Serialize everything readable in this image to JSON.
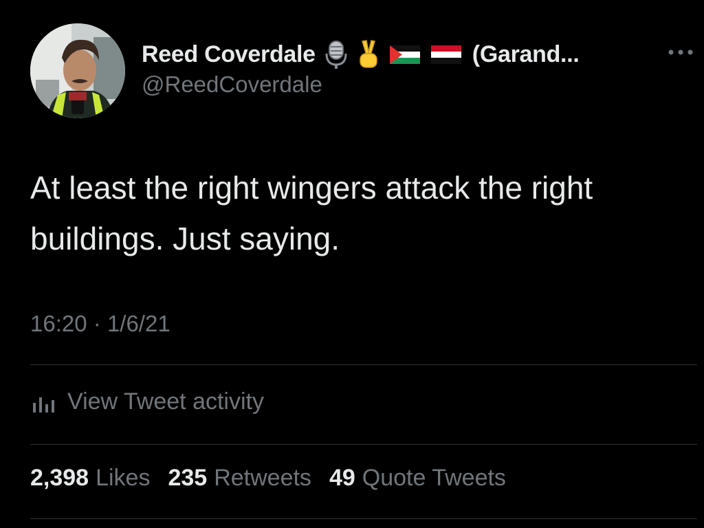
{
  "author": {
    "display_name": "Reed Coverdale",
    "name_emojis": [
      "microphone-icon",
      "victory-hand-icon",
      "palestine-flag-icon",
      "yemen-flag-icon"
    ],
    "name_suffix": "(Garand...",
    "handle": "@ReedCoverdale",
    "avatar": "avatar"
  },
  "tweet": {
    "text": "At least the right wingers attack the right buildings. Just saying.",
    "time": "16:20",
    "separator": "·",
    "date": "1/6/21"
  },
  "activity": {
    "label": "View Tweet activity",
    "icon": "analytics-icon"
  },
  "stats": [
    {
      "count": "2,398",
      "label": "Likes"
    },
    {
      "count": "235",
      "label": "Retweets"
    },
    {
      "count": "49",
      "label": "Quote Tweets"
    }
  ],
  "colors": {
    "background": "#000000",
    "primary_text": "#e7e9ea",
    "secondary_text": "#71767b",
    "divider": "#2f3336"
  }
}
